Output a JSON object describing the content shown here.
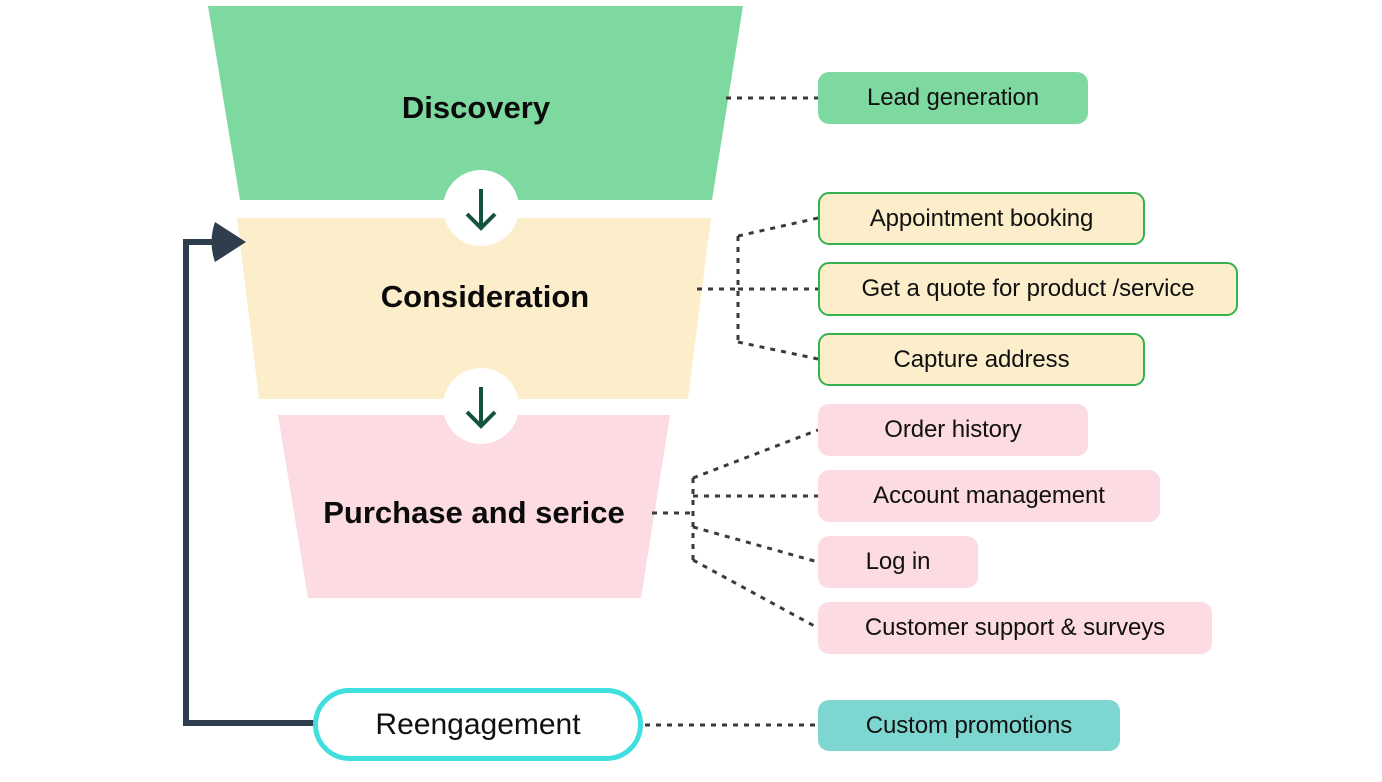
{
  "diagram": {
    "title_visible": false,
    "colors": {
      "discovery_fill": "#7ed9a0",
      "consideration_fill": "#fdeecb",
      "purchase_fill": "#fcdbe2",
      "reengagement_border": "#40dfdf",
      "custom_promotions_fill": "#7dd6d0",
      "pill_border_green": "#35b14e",
      "loop_arrow": "#2f3e4c",
      "stage_arrow": "#14543f",
      "connector": "#3a3a3a",
      "text": "#111111",
      "background": "#ffffff"
    },
    "stages": [
      {
        "id": "discovery",
        "label": "Discovery",
        "fill": "#7ed9a0",
        "items": [
          {
            "label": "Lead generation",
            "fill": "#7ed9a0",
            "bordered": false
          }
        ]
      },
      {
        "id": "consideration",
        "label": "Consideration",
        "fill": "#fdeecb",
        "items": [
          {
            "label": "Appointment booking",
            "fill": "#fdeecb",
            "bordered": true
          },
          {
            "label": "Get a quote for product /service",
            "fill": "#fdeecb",
            "bordered": true
          },
          {
            "label": "Capture address",
            "fill": "#fdeecb",
            "bordered": true
          }
        ]
      },
      {
        "id": "purchase",
        "label": "Purchase and serice",
        "fill": "#fcdbe2",
        "items": [
          {
            "label": "Order history",
            "fill": "#fcdbe2",
            "bordered": false
          },
          {
            "label": "Account management",
            "fill": "#fcdbe2",
            "bordered": false
          },
          {
            "label": "Log in",
            "fill": "#fcdbe2",
            "bordered": false
          },
          {
            "label": "Customer support & surveys",
            "fill": "#fcdbe2",
            "bordered": false
          }
        ]
      },
      {
        "id": "reengagement",
        "label": "Reengagement",
        "fill": "#ffffff",
        "items": [
          {
            "label": "Custom promotions",
            "fill": "#7dd6d0",
            "bordered": false
          }
        ]
      }
    ],
    "flow": {
      "stage_transition_icon": "down-arrow-icon",
      "feedback_loop": {
        "from": "reengagement",
        "to": "consideration",
        "icon": "loop-arrow-icon"
      }
    }
  },
  "pills": {
    "lead_generation": "Lead generation",
    "appointment_booking": "Appointment booking",
    "get_a_quote": "Get a quote for product /service",
    "capture_address": "Capture address",
    "order_history": "Order history",
    "account_management": "Account management",
    "log_in": "Log in",
    "customer_support": "Customer support & surveys",
    "custom_promotions": "Custom promotions"
  },
  "labels": {
    "discovery": "Discovery",
    "consideration": "Consideration",
    "purchase": "Purchase and serice",
    "reengagement": "Reengagement"
  }
}
